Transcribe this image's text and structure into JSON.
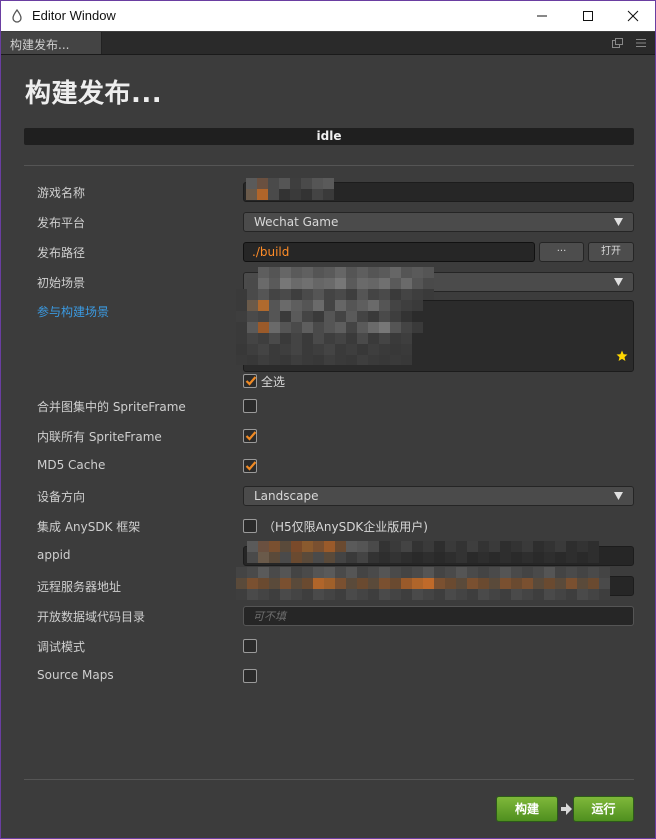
{
  "window": {
    "title": "Editor Window",
    "minimize_icon": "minimize-icon",
    "maximize_icon": "maximize-icon",
    "close_icon": "close-icon"
  },
  "tab": {
    "label": "构建发布..."
  },
  "page": {
    "heading": "构建发布...",
    "status": "idle"
  },
  "form": {
    "game_name": {
      "label": "游戏名称"
    },
    "platform": {
      "label": "发布平台",
      "value": "Wechat Game"
    },
    "build_path": {
      "label": "发布路径",
      "value": "./build",
      "browse_label": "···",
      "open_label": "打开"
    },
    "start_scene": {
      "label": "初始场景"
    },
    "included_scenes": {
      "label": "参与构建场景",
      "select_all_label": "全选"
    },
    "merge_sprite_frames": {
      "label": "合并图集中的 SpriteFrame",
      "checked": false
    },
    "inline_sprite_frames": {
      "label": "内联所有 SpriteFrame",
      "checked": true
    },
    "md5_cache": {
      "label": "MD5 Cache",
      "checked": true
    },
    "orientation": {
      "label": "设备方向",
      "value": "Landscape"
    },
    "anysdk": {
      "label": "集成 AnySDK 框架",
      "note": "（H5仅限AnySDK企业版用户)",
      "checked": false
    },
    "appid": {
      "label": "appid"
    },
    "remote_server": {
      "label": "远程服务器地址"
    },
    "open_data_dir": {
      "label": "开放数据域代码目录",
      "placeholder": "可不填"
    },
    "debug": {
      "label": "调试模式",
      "checked": false
    },
    "source_maps": {
      "label": "Source Maps",
      "checked": false
    }
  },
  "actions": {
    "build_label": "构建",
    "run_label": "运行"
  },
  "colors": {
    "accent_orange": "#ff8c27",
    "link_blue": "#3b9ae1",
    "button_green": "#5fa02a"
  }
}
